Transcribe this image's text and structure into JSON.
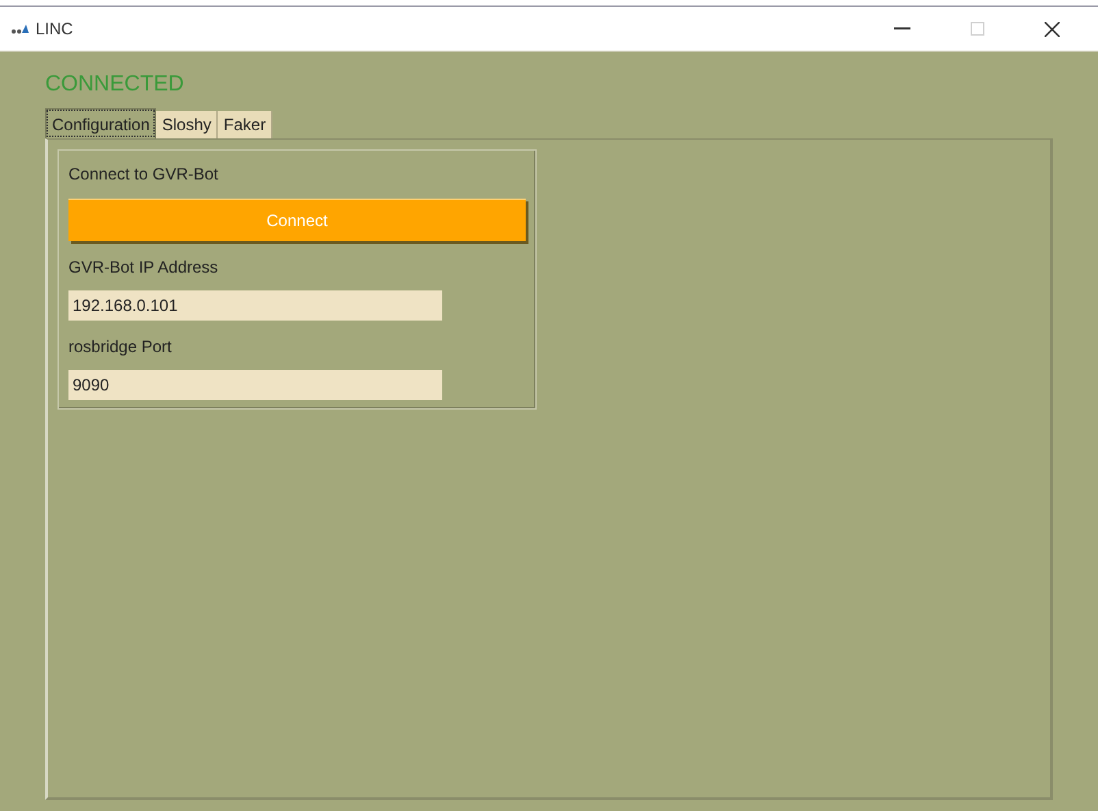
{
  "window": {
    "title": "LINC",
    "maximize_disabled": true
  },
  "status": "CONNECTED",
  "tabs": [
    {
      "label": "Configuration",
      "selected": true
    },
    {
      "label": "Sloshy",
      "selected": false
    },
    {
      "label": "Faker",
      "selected": false
    }
  ],
  "group": {
    "title": "Connect to GVR-Bot",
    "button": "Connect",
    "fields": [
      {
        "label": "GVR-Bot IP Address",
        "value": "192.168.0.101"
      },
      {
        "label": "rosbridge Port",
        "value": "9090"
      }
    ]
  }
}
